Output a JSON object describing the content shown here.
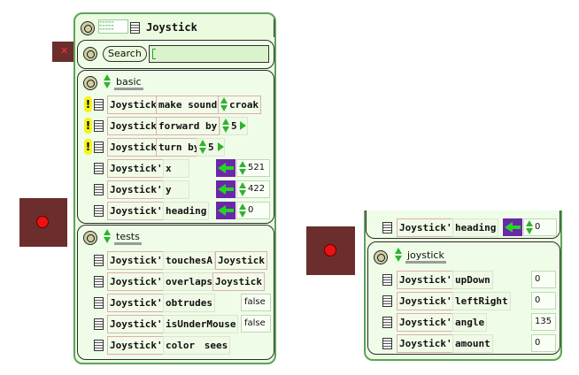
{
  "viewer": {
    "title": "Joystick",
    "search_label": "Search",
    "search_value": ""
  },
  "basic": {
    "category": "basic",
    "commands": [
      {
        "object": "Joystick",
        "verb": "make sound",
        "arg": "croak"
      },
      {
        "object": "Joystick",
        "verb": "forward by",
        "arg": "5"
      },
      {
        "object": "Joystick",
        "verb": "turn by",
        "arg": "5"
      }
    ],
    "properties": [
      {
        "object": "Joystick's",
        "name": "x",
        "value": "521"
      },
      {
        "object": "Joystick's",
        "name": "y",
        "value": "422"
      },
      {
        "object": "Joystick's",
        "name": "heading",
        "value": "0"
      }
    ]
  },
  "tests": {
    "category": "tests",
    "rows": [
      {
        "object": "Joystick's",
        "name": "touchesA",
        "value": "Joystick"
      },
      {
        "object": "Joystick's",
        "name": "overlaps",
        "value": "Joystick"
      },
      {
        "object": "Joystick's",
        "name": "obtrudes",
        "value": "false"
      },
      {
        "object": "Joystick's",
        "name": "isUnderMouse",
        "value": "false"
      },
      {
        "object": "Joystick's",
        "name": "color",
        "value": "sees"
      }
    ]
  },
  "right_viewer": {
    "heading_row": {
      "object": "Joystick's",
      "name": "heading",
      "value": "0"
    },
    "category": "joystick",
    "rows": [
      {
        "object": "Joystick's",
        "name": "upDown",
        "value": "0"
      },
      {
        "object": "Joystick's",
        "name": "leftRight",
        "value": "0"
      },
      {
        "object": "Joystick's",
        "name": "angle",
        "value": "135"
      },
      {
        "object": "Joystick's",
        "name": "amount",
        "value": "0"
      }
    ]
  },
  "colors": {
    "viewer_bg": "#ebfbe0",
    "viewer_border": "#5ba35b",
    "arrow_tile": "#6a28a8",
    "arrow": "#27d227",
    "joystick_base": "#6b2e2c",
    "joystick_knob": "#ee1111",
    "exclaim": "#f5f21d"
  }
}
